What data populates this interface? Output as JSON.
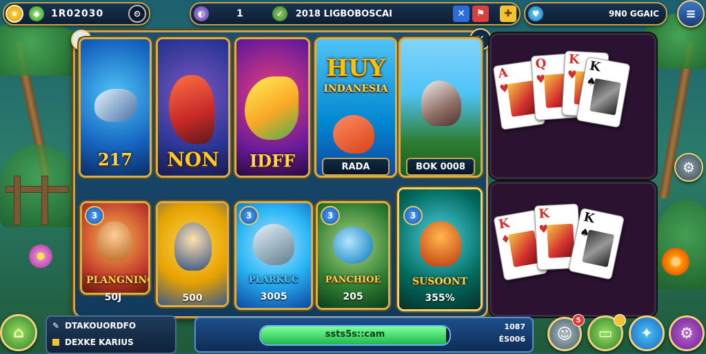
{
  "topbar": {
    "balance": "1R02030",
    "center_count": "1",
    "center_text": "2018 LIGBOBOSCAI",
    "right_text": "9N0 GGAIC"
  },
  "game_cards": [
    {
      "caption": "217",
      "value": ""
    },
    {
      "caption": "NON",
      "value": ""
    },
    {
      "caption": "IDFF",
      "value": ""
    },
    {
      "caption_line1": "HUY",
      "caption_line2": "INDANESIA",
      "value": "RADA"
    },
    {
      "caption": "",
      "value": "BOK 0008"
    }
  ],
  "char_cards": [
    {
      "badge": "3",
      "caption": "PLANGNING",
      "value": "50J"
    },
    {
      "badge": "",
      "caption": "",
      "value": "500"
    },
    {
      "badge": "3",
      "caption": "PLARKUC",
      "value": "3005"
    },
    {
      "badge": "3",
      "caption": "PANCHIOE",
      "value": "205"
    },
    {
      "badge": "3",
      "caption": "SUSOONT",
      "value": "355%"
    }
  ],
  "playing_cards_top": [
    {
      "rank": "A",
      "suit": "♥",
      "color": "#d32f2f"
    },
    {
      "rank": "Q",
      "suit": "♥",
      "color": "#d32f2f"
    },
    {
      "rank": "K",
      "suit": "♥",
      "color": "#d32f2f"
    },
    {
      "rank": "K",
      "suit": "♠",
      "color": "#111111"
    }
  ],
  "playing_cards_bottom": [
    {
      "rank": "K",
      "suit": "♦",
      "color": "#d32f2f"
    },
    {
      "rank": "K",
      "suit": "♥",
      "color": "#d32f2f"
    },
    {
      "rank": "K",
      "suit": "♠",
      "color": "#111111"
    }
  ],
  "bottombar": {
    "info_line1": "DTAKOUORDFO",
    "info_line2": "DEXKE KARIUS",
    "progress_text": "ssts5s::cam",
    "progress_fraction": 0.98,
    "right_line1": "1087",
    "right_line2": "ÉS006",
    "notif_count": "5"
  },
  "colors": {
    "accent_gold": "#c9a44e",
    "progress_green": "#3fe06a",
    "panel_blue": "#1a4f73"
  }
}
